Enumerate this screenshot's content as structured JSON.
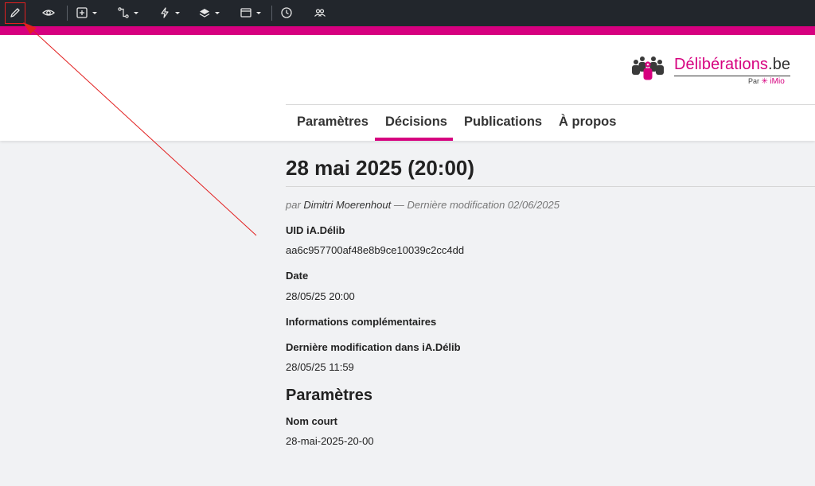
{
  "toolbar": {
    "buttons": [
      {
        "name": "edit",
        "icon": "pencil-icon"
      },
      {
        "name": "view",
        "icon": "eye-icon"
      },
      {
        "name": "add",
        "icon": "plus-square-icon"
      },
      {
        "name": "workflow",
        "icon": "workflow-icon"
      },
      {
        "name": "actions",
        "icon": "lightning-icon"
      },
      {
        "name": "layers",
        "icon": "layers-icon"
      },
      {
        "name": "display",
        "icon": "window-icon"
      },
      {
        "name": "history",
        "icon": "clock-icon"
      },
      {
        "name": "sharing",
        "icon": "users-icon"
      }
    ],
    "accent_color": "#d6007f",
    "background_color": "#22262c"
  },
  "header": {
    "logo": {
      "title_main": "Délibérations",
      "title_suffix": ".be",
      "by": "Par",
      "brand": "iMio"
    },
    "tabs": [
      {
        "label": "Paramètres",
        "active": false
      },
      {
        "label": "Décisions",
        "active": true
      },
      {
        "label": "Publications",
        "active": false
      },
      {
        "label": "À propos",
        "active": false
      }
    ]
  },
  "main": {
    "title": "28 mai 2025 (20:00)",
    "byline": {
      "prefix": "par",
      "author": "Dimitri Moerenhout",
      "suffix": "— Dernière modification 02/06/2025"
    },
    "fields": [
      {
        "label": "UID iA.Délib",
        "value": "aa6c957700af48e8b9ce10039c2cc4dd"
      },
      {
        "label": "Date",
        "value": "28/05/25 20:00"
      },
      {
        "label": "Informations complémentaires",
        "value": ""
      },
      {
        "label": "Dernière modification dans iA.Délib",
        "value": "28/05/25 11:59"
      }
    ],
    "section_title": "Paramètres",
    "section_fields": [
      {
        "label": "Nom court",
        "value": "28-mai-2025-20-00"
      }
    ]
  }
}
